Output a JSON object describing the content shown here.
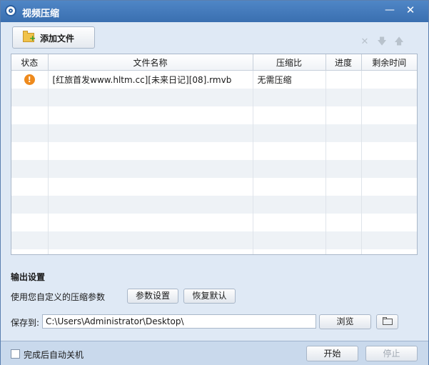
{
  "window": {
    "title": "视频压缩",
    "minimize_label": "—",
    "close_label": "✕"
  },
  "toolbar": {
    "add_file_label": "添加文件",
    "delete_icon": "✕",
    "move_down_icon": "🡇",
    "move_up_icon": "🡅"
  },
  "table": {
    "headers": {
      "status": "状态",
      "filename": "文件名称",
      "ratio": "压缩比",
      "progress": "进度",
      "remaining": "剩余时间"
    },
    "rows": [
      {
        "status_icon": "!",
        "filename": "[红旅首发www.hltm.cc][未来日记][08].rmvb",
        "ratio": "无需压缩",
        "progress": "",
        "remaining": ""
      }
    ]
  },
  "output": {
    "section_title": "输出设置",
    "param_text": "使用您自定义的压缩参数",
    "param_button": "参数设置",
    "reset_button": "恢复默认",
    "save_label": "保存到:",
    "save_path": "C:\\Users\\Administrator\\Desktop\\",
    "browse_button": "浏览"
  },
  "bottom": {
    "shutdown_label": "完成后自动关机",
    "start_button": "开始",
    "stop_button": "停止"
  }
}
